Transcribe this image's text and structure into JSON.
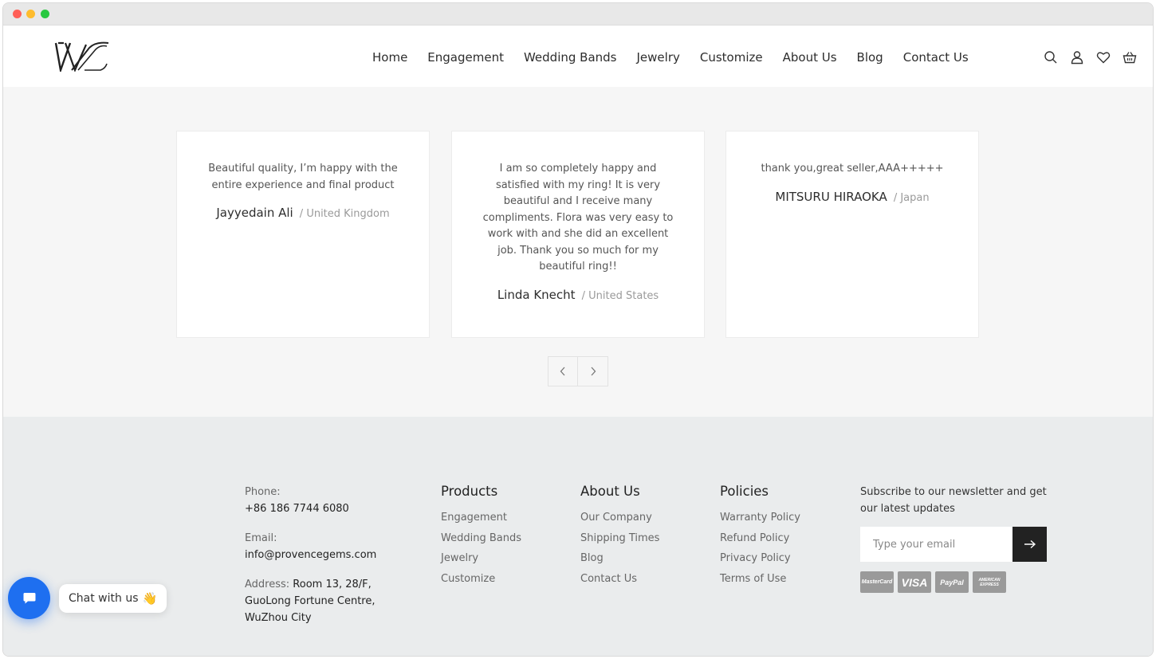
{
  "window": {
    "controls": [
      "close",
      "minimize",
      "zoom"
    ]
  },
  "header": {
    "logo_icon": "wd-logo-icon",
    "nav": [
      "Home",
      "Engagement",
      "Wedding Bands",
      "Jewelry",
      "Customize",
      "About Us",
      "Blog",
      "Contact Us"
    ],
    "icons": [
      "search-icon",
      "account-icon",
      "wishlist-heart-icon",
      "cart-basket-icon"
    ]
  },
  "reviews": [
    {
      "quote": "Beautiful quality, I’m happy with the entire experience and final product",
      "name": "Jayyedain Ali",
      "country": "United Kingdom"
    },
    {
      "quote": "I am so completely happy and satisfied with my ring! It is very beautiful and I receive many compliments. Flora was very easy to work with and she did an excellent job. Thank you so much for my beautiful ring!!",
      "name": "Linda Knecht",
      "country": "United States"
    },
    {
      "quote": "thank you,great seller,AAA+++++",
      "name": "MITSURU HIRAOKA",
      "country": "Japan"
    }
  ],
  "carousel": {
    "prev_icon": "chevron-left-icon",
    "next_icon": "chevron-right-icon"
  },
  "footer": {
    "contact": {
      "phone_label": "Phone:",
      "phone": "+86 186 7744 6080",
      "email_label": "Email:",
      "email": "info@provencegems.com",
      "address_label": "Address:",
      "address": "Room 13, 28/F, GuoLong Fortune Centre, WuZhou City"
    },
    "products": {
      "title": "Products",
      "links": [
        "Engagement",
        "Wedding Bands",
        "Jewelry",
        "Customize"
      ]
    },
    "about": {
      "title": "About Us",
      "links": [
        "Our Company",
        "Shipping Times",
        "Blog",
        "Contact Us"
      ]
    },
    "policies": {
      "title": "Policies",
      "links": [
        "Warranty Policy",
        "Refund Policy",
        "Privacy Policy",
        "Terms of Use"
      ]
    },
    "newsletter": {
      "text": "Subscribe to our newsletter and get our latest updates",
      "placeholder": "Type your email",
      "submit_icon": "arrow-right-icon"
    },
    "payments": [
      "MasterCard",
      "VISA",
      "PayPal",
      "AMERICAN EXPRESS"
    ]
  },
  "chat": {
    "label": "Chat with us",
    "emoji": "👋",
    "icon": "chat-bubble-icon"
  },
  "colors": {
    "accent": "#1e6ff0",
    "dark": "#222222",
    "footer_bg": "#eaeced",
    "section_bg": "#f6f6f6"
  }
}
